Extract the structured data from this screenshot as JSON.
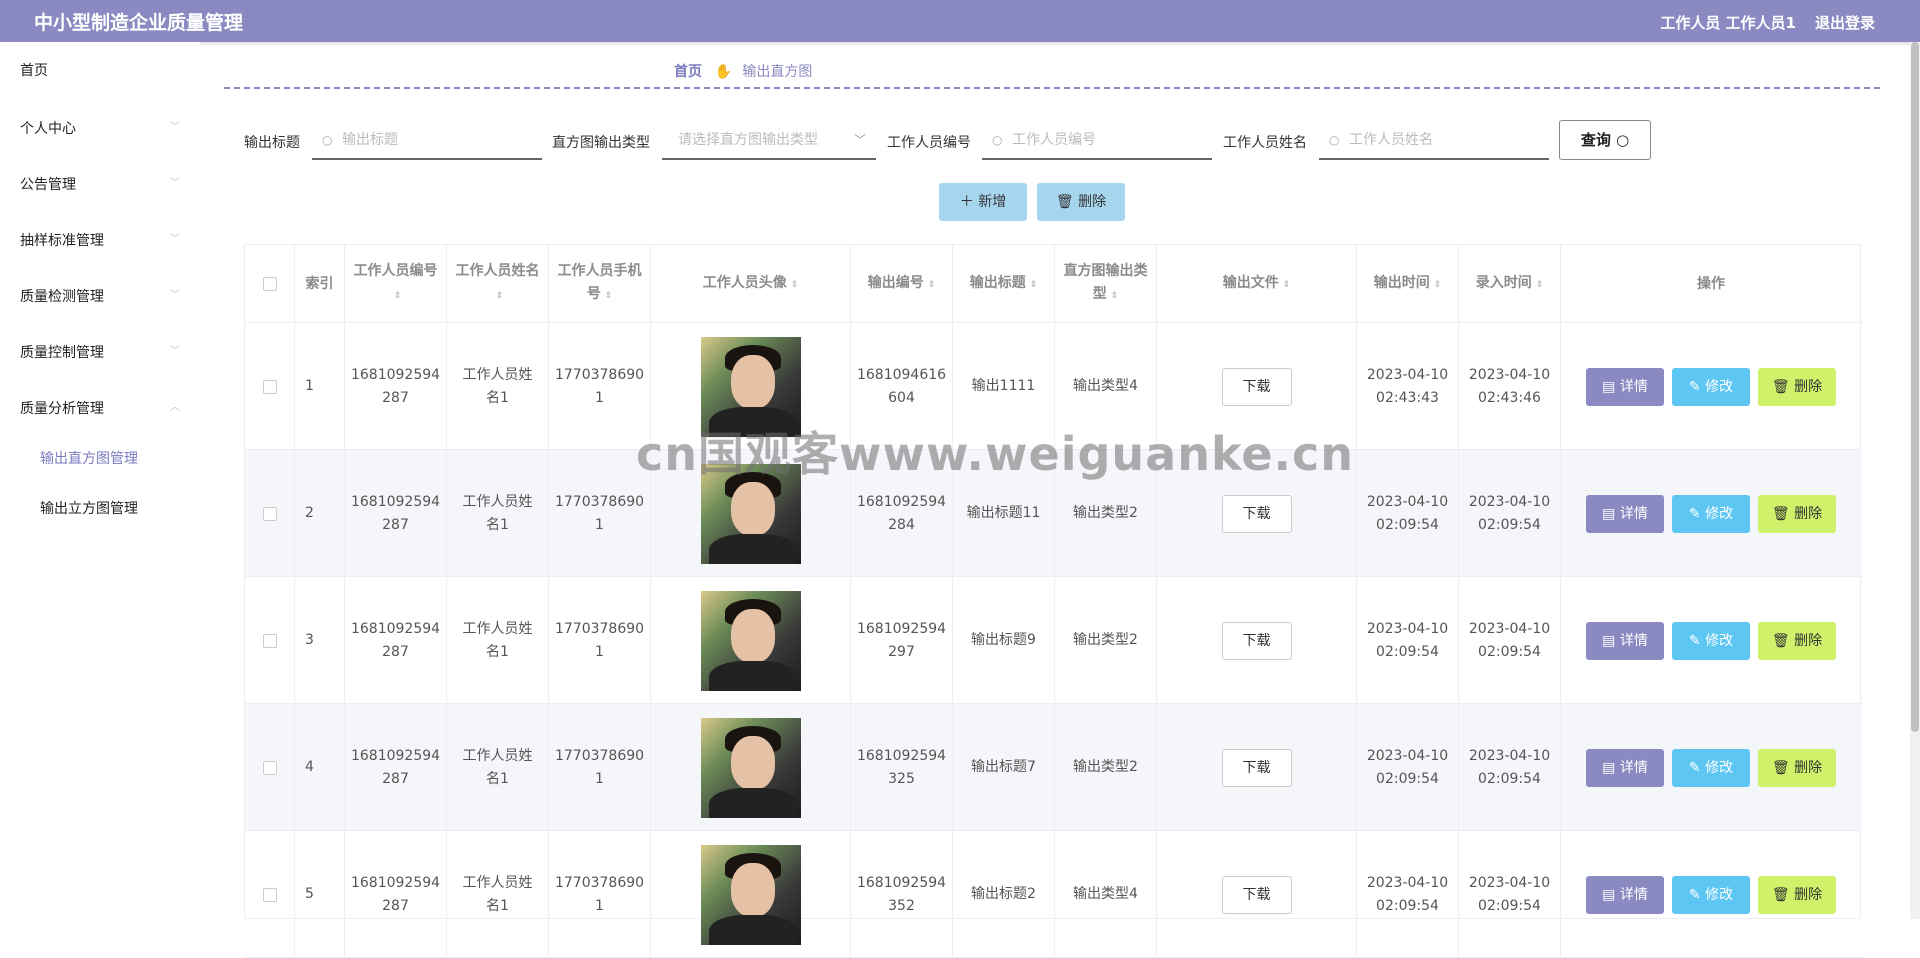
{
  "header": {
    "title": "中小型制造企业质量管理",
    "user": "工作人员 工作人员1",
    "logout": "退出登录"
  },
  "sidebar": {
    "items": [
      {
        "label": "首页"
      },
      {
        "label": "个人中心"
      },
      {
        "label": "公告管理"
      },
      {
        "label": "抽样标准管理"
      },
      {
        "label": "质量检测管理"
      },
      {
        "label": "质量控制管理"
      },
      {
        "label": "质量分析管理"
      }
    ],
    "submenu": [
      {
        "label": "输出直方图管理"
      },
      {
        "label": "输出立方图管理"
      }
    ]
  },
  "breadcrumb": {
    "home": "首页",
    "current": "输出直方图"
  },
  "search": {
    "title_label": "输出标题",
    "title_placeholder": "输出标题",
    "type_label": "直方图输出类型",
    "type_placeholder": "请选择直方图输出类型",
    "staff_no_label": "工作人员编号",
    "staff_no_placeholder": "工作人员编号",
    "staff_name_label": "工作人员姓名",
    "staff_name_placeholder": "工作人员姓名",
    "query_label": "查询"
  },
  "actions": {
    "add": "新增",
    "delete": "删除"
  },
  "table": {
    "headers": {
      "index": "索引",
      "staff_no": "工作人员编号",
      "staff_name": "工作人员姓名",
      "staff_phone": "工作人员手机号",
      "avatar": "工作人员头像",
      "output_no": "输出编号",
      "output_title": "输出标题",
      "hist_type": "直方图输出类型",
      "output_file": "输出文件",
      "output_time": "输出时间",
      "entry_time": "录入时间",
      "ops": "操作"
    },
    "download_label": "下载",
    "op_detail": "详情",
    "op_edit": "修改",
    "op_delete": "删除",
    "rows": [
      {
        "index": "1",
        "staff_no_a": "1681092594",
        "staff_no_b": "287",
        "staff_name_a": "工作人员姓",
        "staff_name_b": "名1",
        "phone_a": "1770378690",
        "phone_b": "1",
        "output_no_a": "1681094616",
        "output_no_b": "604",
        "title": "输出1111",
        "type": "输出类型4",
        "out_date": "2023-04-10",
        "out_time": "02:43:43",
        "entry_date": "2023-04-10",
        "entry_time": "02:43:46"
      },
      {
        "index": "2",
        "staff_no_a": "1681092594",
        "staff_no_b": "287",
        "staff_name_a": "工作人员姓",
        "staff_name_b": "名1",
        "phone_a": "1770378690",
        "phone_b": "1",
        "output_no_a": "1681092594",
        "output_no_b": "284",
        "title": "输出标题11",
        "type": "输出类型2",
        "out_date": "2023-04-10",
        "out_time": "02:09:54",
        "entry_date": "2023-04-10",
        "entry_time": "02:09:54"
      },
      {
        "index": "3",
        "staff_no_a": "1681092594",
        "staff_no_b": "287",
        "staff_name_a": "工作人员姓",
        "staff_name_b": "名1",
        "phone_a": "1770378690",
        "phone_b": "1",
        "output_no_a": "1681092594",
        "output_no_b": "297",
        "title": "输出标题9",
        "type": "输出类型2",
        "out_date": "2023-04-10",
        "out_time": "02:09:54",
        "entry_date": "2023-04-10",
        "entry_time": "02:09:54"
      },
      {
        "index": "4",
        "staff_no_a": "1681092594",
        "staff_no_b": "287",
        "staff_name_a": "工作人员姓",
        "staff_name_b": "名1",
        "phone_a": "1770378690",
        "phone_b": "1",
        "output_no_a": "1681092594",
        "output_no_b": "325",
        "title": "输出标题7",
        "type": "输出类型2",
        "out_date": "2023-04-10",
        "out_time": "02:09:54",
        "entry_date": "2023-04-10",
        "entry_time": "02:09:54"
      },
      {
        "index": "5",
        "staff_no_a": "1681092594",
        "staff_no_b": "287",
        "staff_name_a": "工作人员姓",
        "staff_name_b": "名1",
        "phone_a": "1770378690",
        "phone_b": "1",
        "output_no_a": "1681092594",
        "output_no_b": "352",
        "title": "输出标题2",
        "type": "输出类型4",
        "out_date": "2023-04-10",
        "out_time": "02:09:54",
        "entry_date": "2023-04-10",
        "entry_time": "02:09:54"
      }
    ]
  },
  "watermark": "cn国观客www.weiguanke.cn"
}
